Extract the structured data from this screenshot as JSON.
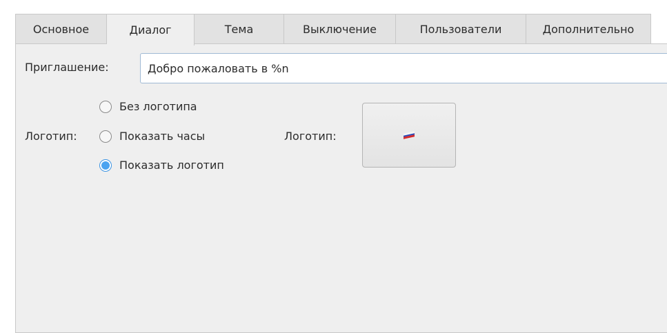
{
  "tabs": [
    {
      "label": "Основное",
      "active": false
    },
    {
      "label": "Диалог",
      "active": true
    },
    {
      "label": "Тема",
      "active": false
    },
    {
      "label": "Выключение",
      "active": false
    },
    {
      "label": "Пользователи",
      "active": false
    },
    {
      "label": "Дополнительно",
      "active": false
    }
  ],
  "greeting": {
    "label": "Приглашение:",
    "value": "Добро пожаловать в %n"
  },
  "logo_mode": {
    "label": "Логотип:",
    "options": [
      {
        "label": "Без логотипа",
        "checked": false
      },
      {
        "label": "Показать часы",
        "checked": false
      },
      {
        "label": "Показать логотип",
        "checked": true
      }
    ]
  },
  "logo_picker": {
    "label": "Логотип:",
    "icon": "russian-flag-icon"
  },
  "colors": {
    "accent": "#4aa3f0",
    "panel_bg": "#efefef",
    "tab_bg": "#e2e2e2"
  }
}
